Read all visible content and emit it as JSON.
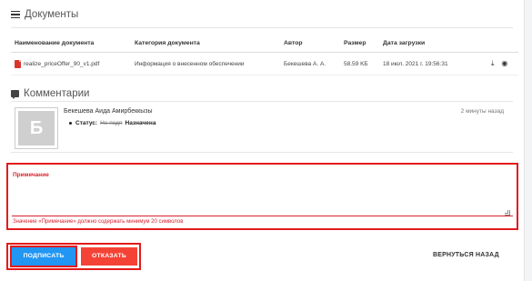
{
  "documents": {
    "title": "Документы",
    "columns": [
      "Наименование документа",
      "Категория документа",
      "Автор",
      "Размер",
      "Дата загрузки"
    ],
    "rows": [
      {
        "name": "realize_priceOffer_90_v1.pdf",
        "category": "Информация о внесенном обеспечении",
        "author": "Бекешева А. А.",
        "size": "58.59 KБ",
        "date": "18 июл. 2021 г. 19:56:31"
      }
    ],
    "actions": {
      "download_icon": "download-icon",
      "view_icon": "eye-icon"
    }
  },
  "comments": {
    "title": "Комментарии",
    "items": [
      {
        "avatar_letter": "Б",
        "author": "Бекешева Аида Амирбеккызы",
        "time": "2 минуты назад",
        "status_label": "Статус:",
        "status_old": "Не подп",
        "status_new": "Назначена"
      }
    ]
  },
  "note": {
    "label": "Примечание",
    "value": "",
    "error": "Значение «Примечание» должно содержать минимум 20 символов"
  },
  "buttons": {
    "sign": "ПОДПИСАТЬ",
    "reject": "ОТКАЗАТЬ",
    "back": "ВЕРНУТЬСЯ НАЗАД"
  },
  "colors": {
    "accent_blue": "#2196f3",
    "accent_red": "#f44336",
    "highlight_outline": "#e21b1b"
  }
}
